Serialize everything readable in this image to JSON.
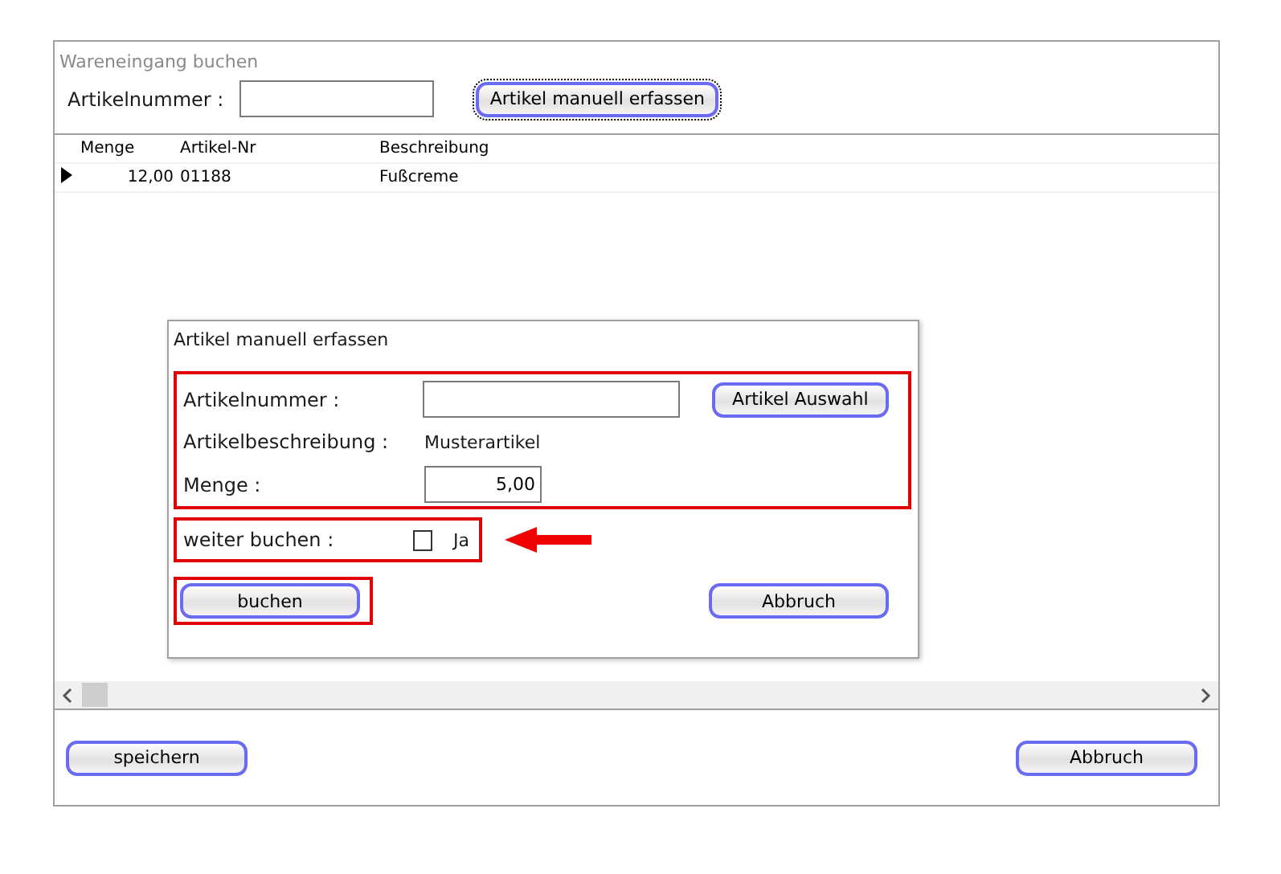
{
  "window": {
    "title": "Wareneingang buchen"
  },
  "search": {
    "label": "Artikelnummer :",
    "button": "Artikel manuell erfassen",
    "button_focused": true
  },
  "table": {
    "columns": [
      "Menge",
      "Artikel-Nr",
      "Beschreibung"
    ],
    "rows": [
      {
        "current": true,
        "cells": [
          "12,00",
          "01188",
          "Fußcreme"
        ]
      }
    ]
  },
  "dialog": {
    "title": "Artikel manuell erfassen",
    "artikelnummer": {
      "label": "Artikelnummer :",
      "button": "Artikel Auswahl"
    },
    "beschreibung": {
      "label": "Artikelbeschreibung :",
      "value": "Musterartikel"
    },
    "menge": {
      "label": "Menge :",
      "value": "5,00"
    },
    "weiter": {
      "label": "weiter buchen :",
      "checkbox_label": "Ja",
      "checked": false
    },
    "buttons": [
      "buchen",
      "Abbruch"
    ]
  },
  "footer_buttons": [
    "speichern",
    "Abbruch"
  ]
}
